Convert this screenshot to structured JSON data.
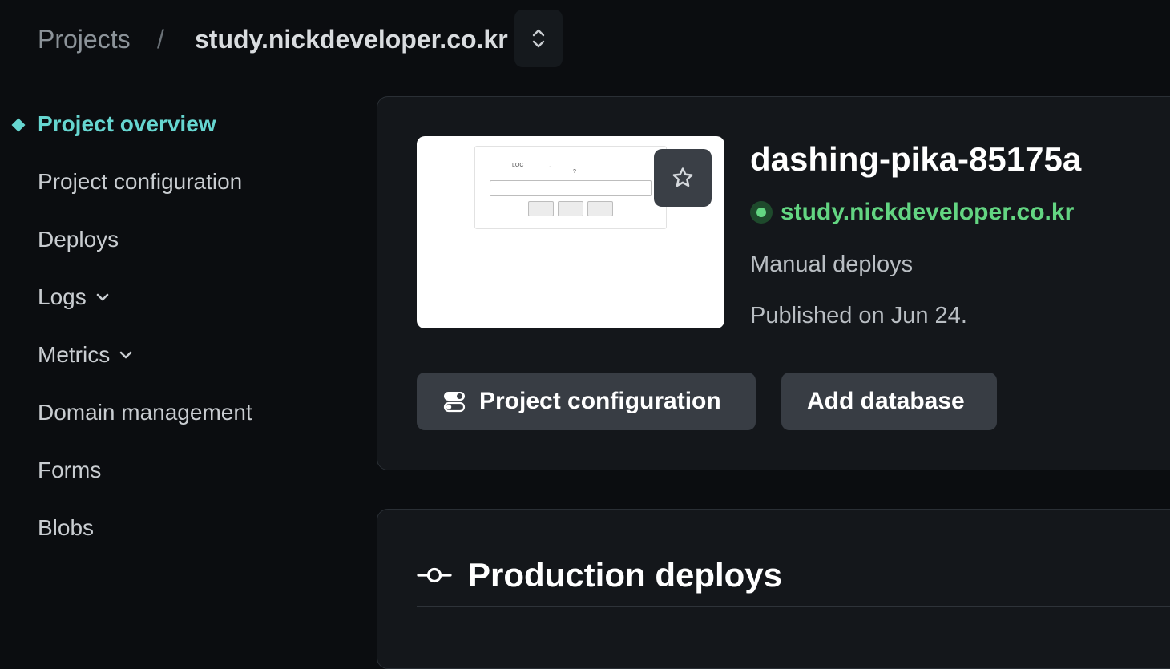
{
  "breadcrumb": {
    "root": "Projects",
    "separator": "/",
    "current": "study.nickdeveloper.co.kr"
  },
  "sidebar": {
    "items": [
      {
        "label": "Project overview",
        "active": true
      },
      {
        "label": "Project configuration"
      },
      {
        "label": "Deploys"
      },
      {
        "label": "Logs",
        "chevron": "chevron-down-icon"
      },
      {
        "label": "Metrics",
        "chevron": "chevron-down-icon"
      },
      {
        "label": "Domain management"
      },
      {
        "label": "Forms"
      },
      {
        "label": "Blobs"
      }
    ]
  },
  "overview": {
    "site_name": "dashing-pika-85175a",
    "site_url": "study.nickdeveloper.co.kr",
    "deploy_mode": "Manual deploys",
    "published": "Published on Jun 24.",
    "thumbnail": {
      "text_a": "LOC",
      "text_b": "·",
      "text_c": "?"
    },
    "buttons": {
      "config_label": "Project configuration",
      "db_label": "Add database"
    }
  },
  "deploys_section": {
    "title": "Production deploys",
    "icon": "commit-icon"
  },
  "colors": {
    "accent": "#66d6d0",
    "success": "#63d582",
    "background": "#0b0d10",
    "card": "#14171b"
  }
}
